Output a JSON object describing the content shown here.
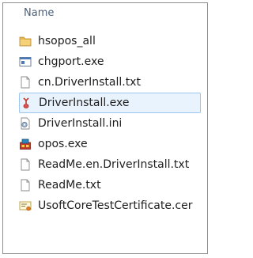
{
  "column_header": "Name",
  "files": [
    {
      "name": "hsopos_all",
      "icon": "folder-icon",
      "selected": false
    },
    {
      "name": "chgport.exe",
      "icon": "exe-window-icon",
      "selected": false
    },
    {
      "name": "cn.DriverInstall.txt",
      "icon": "text-file-icon",
      "selected": false
    },
    {
      "name": "DriverInstall.exe",
      "icon": "installer-icon",
      "selected": true
    },
    {
      "name": "DriverInstall.ini",
      "icon": "settings-file-icon",
      "selected": false
    },
    {
      "name": "opos.exe",
      "icon": "app-exe-icon",
      "selected": false
    },
    {
      "name": "ReadMe.en.DriverInstall.txt",
      "icon": "text-file-icon",
      "selected": false
    },
    {
      "name": "ReadMe.txt",
      "icon": "text-file-icon",
      "selected": false
    },
    {
      "name": "UsoftCoreTestCertificate.cer",
      "icon": "certificate-icon",
      "selected": false
    }
  ],
  "colors": {
    "selection_background": "#e9f3fe",
    "selection_border": "#9cc5ef",
    "header_text": "#4c607a"
  }
}
